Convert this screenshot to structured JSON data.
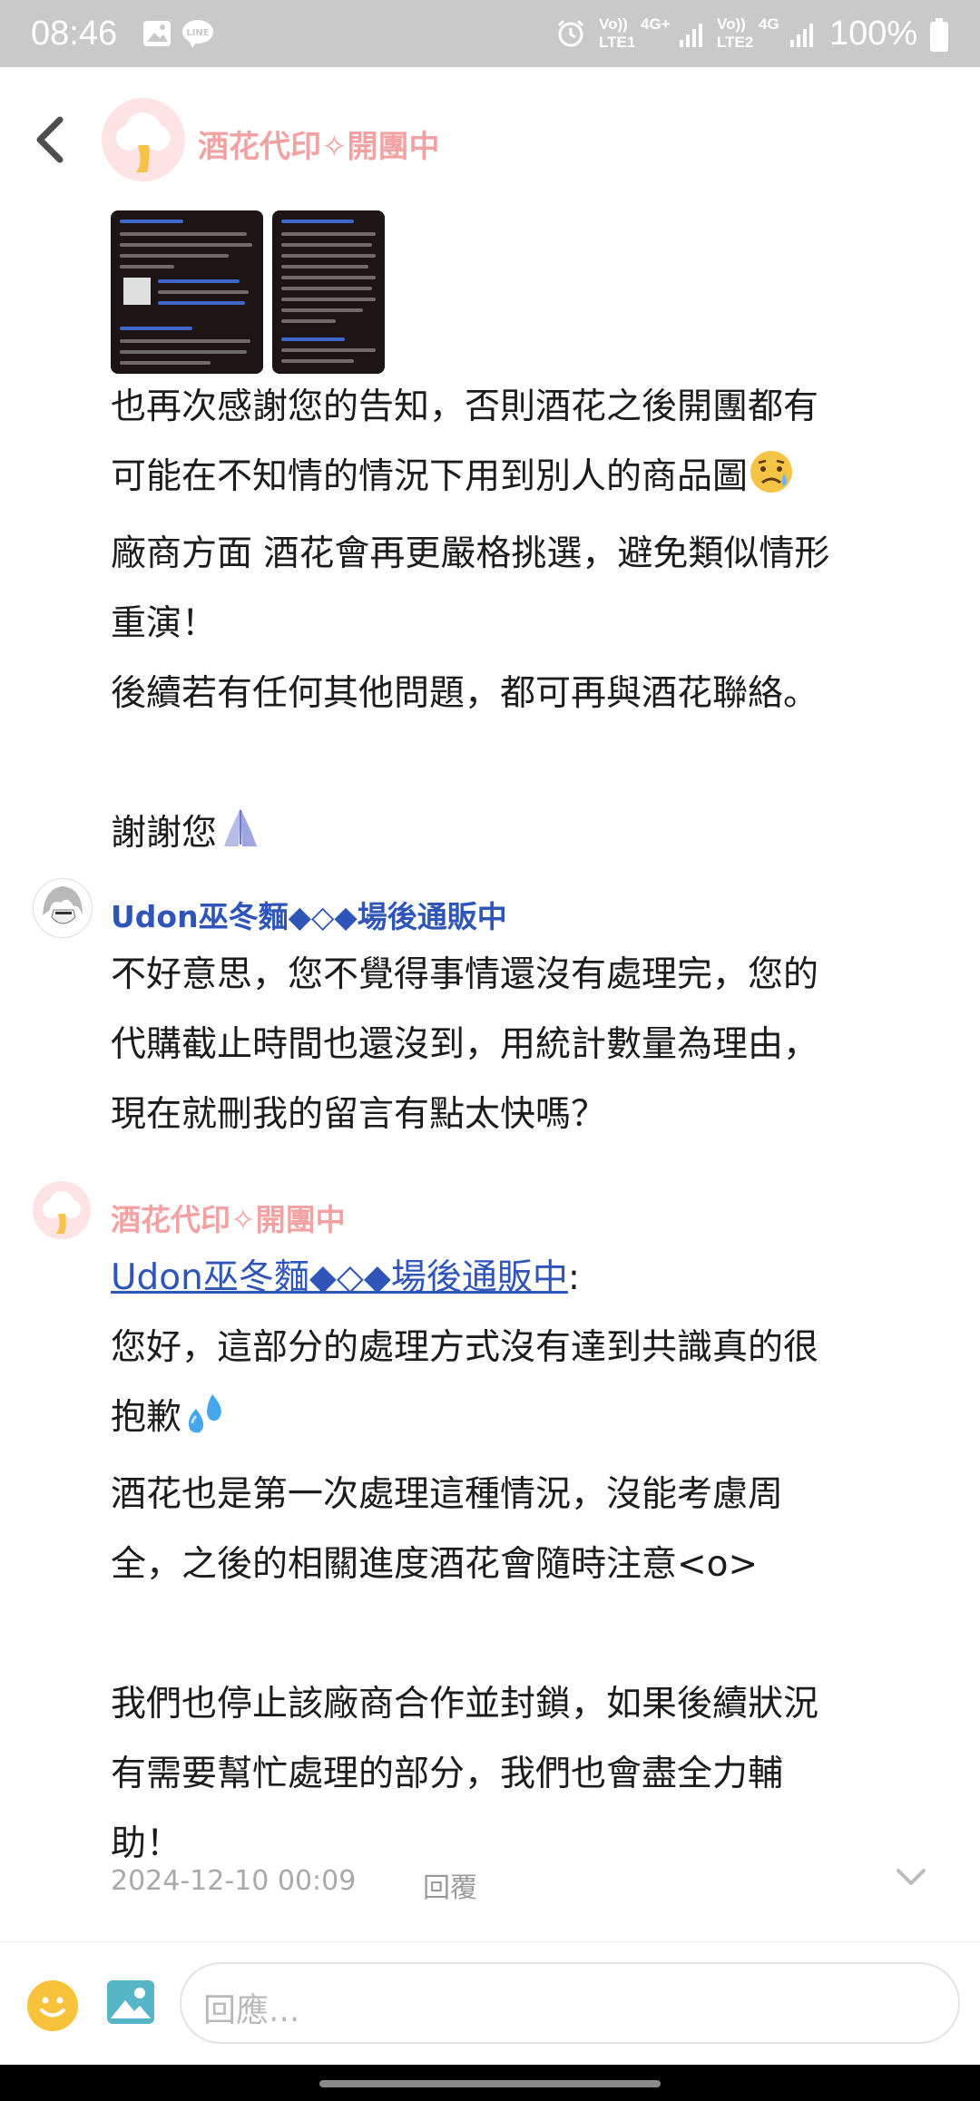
{
  "status_bar": {
    "time": "08:46",
    "net1": "Vo))",
    "net1_sub": "LTE1",
    "net2": "4G+",
    "net3": "Vo))",
    "net3_sub": "LTE2",
    "net4": "4G",
    "battery": "100%",
    "icons": [
      "gallery-icon",
      "line-app-icon",
      "alarm-icon",
      "signal-icon",
      "battery-icon"
    ]
  },
  "header": {
    "title": "酒花代印✧開團中"
  },
  "message1": {
    "lines": [
      "也再次感謝您的告知，否則酒花之後開團都有",
      "可能在不知情的情況下用到別人的商品圖",
      "廠商方面 酒花會再更嚴格挑選，避免類似情形",
      "重演！",
      "後續若有任何其他問題，都可再與酒花聯絡。",
      "",
      "謝謝您"
    ],
    "emoji_sad": "😥",
    "emoji_pray": "🙏"
  },
  "comment2": {
    "author": "Udon巫冬麵◆◇◆場後通販中",
    "lines": [
      "不好意思，您不覺得事情還沒有處理完，您的",
      "代購截止時間也還沒到，用統計數量為理由，",
      "現在就刪我的留言有點太快嗎？"
    ]
  },
  "comment3": {
    "author": "酒花代印✧開團中",
    "mention": "Udon巫冬麵◆◇◆場後通販中",
    "mention_suffix": ":",
    "lines": [
      "您好，這部分的處理方式沒有達到共識真的很",
      "抱歉",
      "酒花也是第一次處理這種情況，沒能考慮周",
      "全，之後的相關進度酒花會隨時注意<o>",
      "",
      "我們也停止該廠商合作並封鎖，如果後續狀況",
      "有需要幫忙處理的部分，我們也會盡全力輔",
      "助！"
    ],
    "emoji_sweat": "💦",
    "timestamp": "2024-12-10 00:09",
    "reply_label": "回覆"
  },
  "composer": {
    "placeholder": "回應..."
  },
  "colors": {
    "brand_pink": "#f2a2a2",
    "link_blue": "#2f55b8",
    "status_bar_bg": "#c9c9c9"
  }
}
